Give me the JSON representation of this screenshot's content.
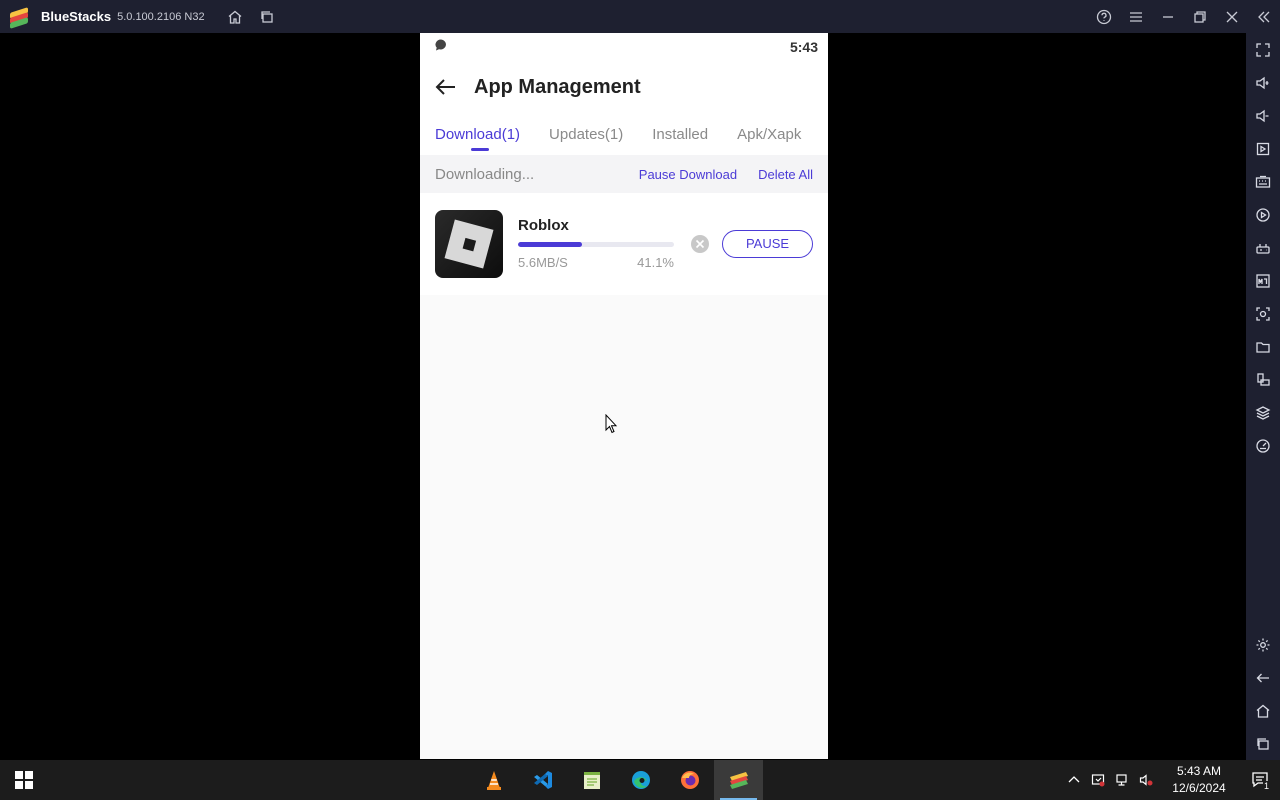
{
  "window": {
    "app_name": "BlueStacks",
    "version": "5.0.100.2106 N32"
  },
  "phone": {
    "status_time": "5:43",
    "title": "App Management",
    "tabs": [
      {
        "label": "Download(1)",
        "active": true
      },
      {
        "label": "Updates(1)",
        "active": false
      },
      {
        "label": "Installed",
        "active": false
      },
      {
        "label": "Apk/Xapk",
        "active": false
      }
    ],
    "section": {
      "label": "Downloading...",
      "pause_all": "Pause Download",
      "delete_all": "Delete All"
    },
    "downloads": [
      {
        "name": "Roblox",
        "speed": "5.6MB/S",
        "percent_text": "41.1%",
        "progress": 0.411,
        "action": "PAUSE"
      }
    ]
  },
  "sidebar": {
    "items": [
      "fullscreen-icon",
      "volume-up-icon",
      "volume-down-icon",
      "media-icon",
      "keyboard-icon",
      "record-icon",
      "gamepad-icon",
      "apk-install-icon",
      "screenshot-icon",
      "folder-icon",
      "multi-instance-icon",
      "layers-icon",
      "eco-mode-icon"
    ],
    "bottom": [
      "settings-icon",
      "back-icon",
      "home-icon",
      "recent-apps-icon"
    ]
  },
  "taskbar": {
    "apps": [
      "vlc-icon",
      "vscode-icon",
      "notepad-plus-icon",
      "edge-icon",
      "firefox-icon",
      "bluestacks-icon"
    ],
    "time": "5:43 AM",
    "date": "12/6/2024",
    "notification_count": "1"
  },
  "colors": {
    "accent": "#4b3bd6",
    "titlebar": "#1e2030",
    "taskbar": "#1c1c1c"
  }
}
